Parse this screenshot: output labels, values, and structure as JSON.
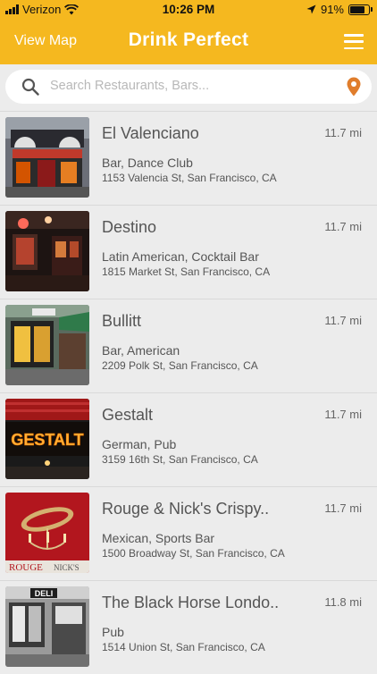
{
  "status_bar": {
    "carrier": "Verizon",
    "time": "10:26 PM",
    "battery": "91%",
    "battery_level": 0.91
  },
  "header": {
    "view_map_label": "View Map",
    "brand": "Drink Perfect",
    "menu_icon": "hamburger-menu-icon",
    "accent_color": "#f5b81f"
  },
  "search": {
    "placeholder": "Search Restaurants, Bars...",
    "value": "",
    "search_icon": "search-icon",
    "location_icon": "location-pin-icon",
    "location_icon_color": "#e07d2c"
  },
  "venues": [
    {
      "name": "El Valenciano",
      "distance": "11.7 mi",
      "category": "Bar, Dance Club",
      "address": "1153 Valencia St, San Francisco, CA"
    },
    {
      "name": "Destino",
      "distance": "11.7 mi",
      "category": "Latin American, Cocktail Bar",
      "address": "1815 Market St, San Francisco, CA"
    },
    {
      "name": "Bullitt",
      "distance": "11.7 mi",
      "category": "Bar, American",
      "address": "2209 Polk St, San Francisco, CA"
    },
    {
      "name": "Gestalt",
      "distance": "11.7 mi",
      "category": "German, Pub",
      "address": "3159 16th St, San Francisco, CA"
    },
    {
      "name": "Rouge & Nick's Crispy..",
      "distance": "11.7 mi",
      "category": "Mexican, Sports Bar",
      "address": "1500 Broadway St, San Francisco, CA"
    },
    {
      "name": "The Black Horse Londo..",
      "distance": "11.8 mi",
      "category": "Pub",
      "address": "1514 Union St, San Francisco, CA"
    }
  ],
  "thumb_signs": {
    "gestalt": "GESTALT",
    "rouge_left": "ROUGE",
    "rouge_right": "NICK'S",
    "deli": "DELI"
  }
}
